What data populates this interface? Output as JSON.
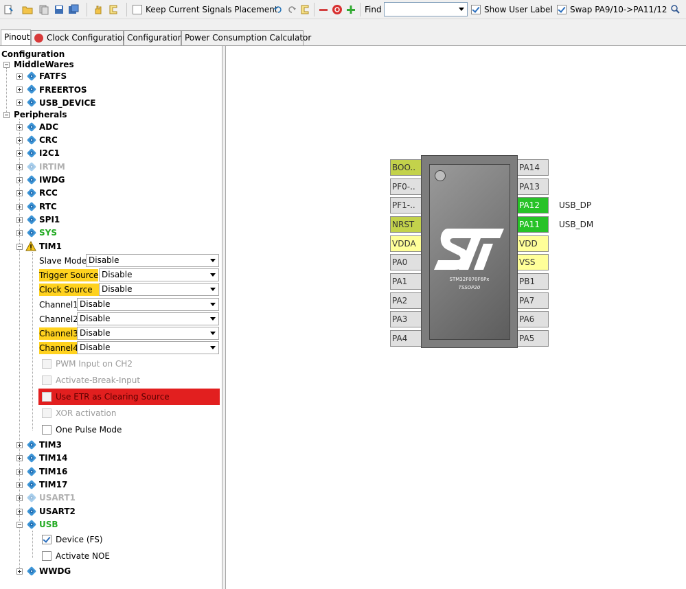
{
  "toolbar": {
    "keep_signals": "Keep Current Signals Placement",
    "find_label": "Find",
    "find_value": "",
    "show_user_label": "Show User Label",
    "swap_label": "Swap PA9/10->PA11/12"
  },
  "tabs": [
    "Pinout",
    "Clock Configuration",
    "Configuration",
    "Power Consumption Calculator"
  ],
  "tree": {
    "root": "Configuration",
    "middlewares": "MiddleWares",
    "mw_items": [
      "FATFS",
      "FREERTOS",
      "USB_DEVICE"
    ],
    "peripherals": "Peripherals",
    "per_items_a": [
      "ADC",
      "CRC",
      "I2C1",
      "IRTIM",
      "IWDG",
      "RCC",
      "RTC",
      "SPI1",
      "SYS",
      "TIM1"
    ],
    "tim1": {
      "slave_mode_label": "Slave Mode",
      "slave_mode_value": "Disable",
      "trigger_label": "Trigger Source",
      "trigger_value": "Disable",
      "clock_label": "Clock Source",
      "clock_value": "Disable",
      "ch1_label": "Channel1",
      "ch1_value": "Disable",
      "ch2_label": "Channel2",
      "ch2_value": "Disable",
      "ch3_label": "Channel3",
      "ch3_value": "Disable",
      "ch4_label": "Channel4",
      "ch4_value": "Disable",
      "pwm_input": "PWM Input on CH2",
      "activate_break": "Activate-Break-Input",
      "use_etr": "Use ETR as Clearing Source",
      "xor": "XOR activation",
      "one_pulse": "One Pulse Mode"
    },
    "per_items_b": [
      "TIM3",
      "TIM14",
      "TIM16",
      "TIM17",
      "USART1",
      "USART2",
      "USB"
    ],
    "usb": {
      "device": "Device (FS)",
      "activate_noe": "Activate NOE"
    },
    "per_items_c": [
      "WWDG"
    ]
  },
  "chip": {
    "name": "STM32F070F6Px",
    "package": "TSSOP20",
    "left_pins": [
      "BOO..",
      "PF0-..",
      "PF1-..",
      "NRST",
      "VDDA",
      "PA0",
      "PA1",
      "PA2",
      "PA3",
      "PA4"
    ],
    "right_pins": [
      "PA14",
      "PA13",
      "PA12",
      "PA11",
      "VDD",
      "VSS",
      "PB1",
      "PA7",
      "PA6",
      "PA5"
    ],
    "pin_labels": {
      "PA12": "USB_DP",
      "PA11": "USB_DM"
    }
  }
}
